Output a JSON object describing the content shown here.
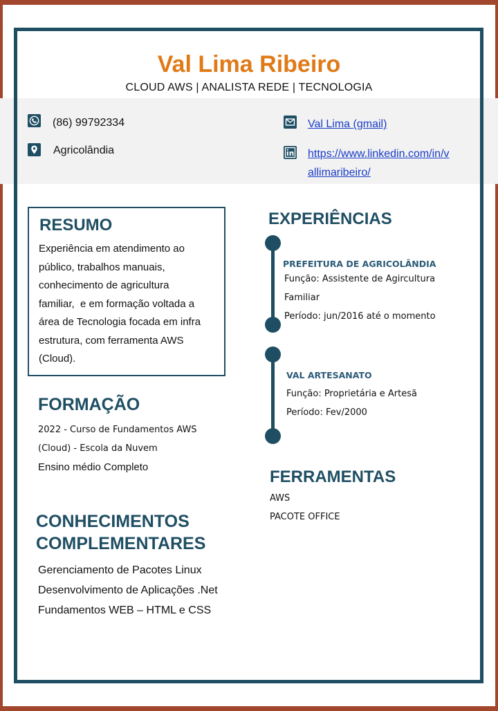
{
  "header": {
    "name": "Val Lima Ribeiro",
    "subtitle": "CLOUD AWS | ANALISTA REDE | TECNOLOGIA"
  },
  "contact": {
    "phone": "(86) 99792334",
    "city": "Agricolândia",
    "email_link": "Val Lima (gmail)",
    "linkedin_line1": "https://www.linkedin.com/in/v",
    "linkedin_line2": "allimaribeiro/",
    "icons": [
      "phone-icon",
      "location-icon",
      "email-icon",
      "linkedin-icon"
    ]
  },
  "resumo": {
    "title": "RESUMO",
    "lines": [
      "Experiência em atendimento ao",
      "público, trabalhos manuais,",
      "conhecimento de agricultura",
      "familiar,  e em formação voltada a",
      "área de Tecnologia focada em infra",
      "estrutura, com ferramenta AWS",
      "(Cloud)."
    ]
  },
  "formacao": {
    "title": "FORMAÇÃO",
    "course_line1": "2022 - Curso de Fundamentos AWS",
    "course_line2": "(Cloud) - Escola da Nuvem",
    "school": "Ensino médio Completo"
  },
  "conhecimentos": {
    "title_line1": "CONHECIMENTOS",
    "title_line2": "COMPLEMENTARES",
    "items": [
      "Gerenciamento de Pacotes Linux",
      "Desenvolvimento de Aplicações .Net",
      "Fundamentos WEB – HTML e CSS"
    ]
  },
  "experiencias": {
    "title": "EXPERIÊNCIAS",
    "items": [
      {
        "company": "PREFEITURA DE AGRICOLÂNDIA",
        "role_line1": "Função: Assistente de Agircultura",
        "role_line2": "Familiar",
        "period": "Período: jun/2016 até o momento"
      },
      {
        "company": "VAL ARTESANATO",
        "role_line1": "Função: Proprietária e Artesã",
        "period": "Período: Fev/2000"
      }
    ]
  },
  "ferramentas": {
    "title": "FERRAMENTAS",
    "items": [
      "AWS",
      "PACOTE OFFICE"
    ]
  },
  "colors": {
    "accent_orange": "#e07a17",
    "primary_blue": "#1f4e63",
    "frame_red": "#a2472d",
    "link_blue": "#1a3cc8"
  }
}
